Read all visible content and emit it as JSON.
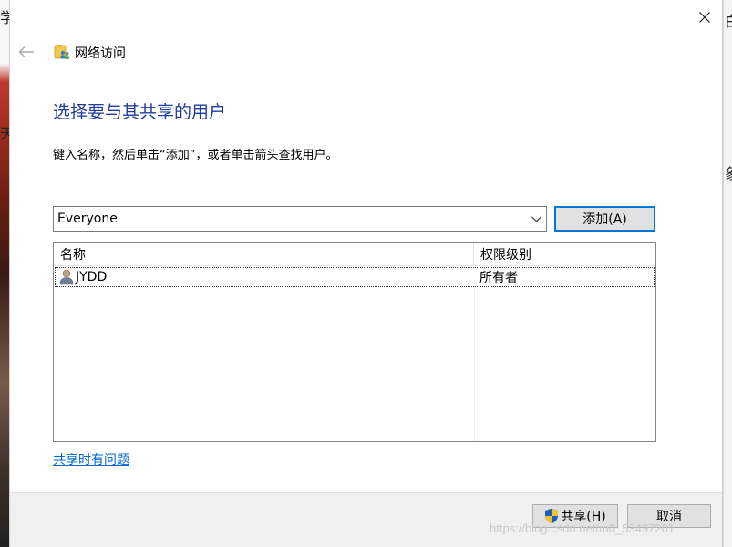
{
  "window": {
    "title": "网络访问",
    "icon": "shared-folder-users-icon"
  },
  "background": {
    "left_chars": [
      "学",
      "天"
    ],
    "right_chars": [
      "白",
      "象"
    ]
  },
  "page": {
    "heading": "选择要与其共享的用户",
    "instructions": "键入名称，然后单击“添加”，或者单击箭头查找用户。"
  },
  "user_input": {
    "value": "Everyone",
    "icon": "chevron-down-icon"
  },
  "add_button": {
    "label": "添加(A)"
  },
  "list": {
    "columns": [
      "名称",
      "权限级别"
    ],
    "rows": [
      {
        "name": "JYDD",
        "permission": "所有者",
        "icon": "user-icon"
      }
    ]
  },
  "help_link": {
    "label": "共享时有问题"
  },
  "footer": {
    "share_label": "共享(H)",
    "cancel_label": "取消"
  },
  "watermark": "https://blog.csdn.net/m0_53497201",
  "colors": {
    "heading": "#1f3d99",
    "link": "#0066cc",
    "accent": "#0078d7"
  }
}
